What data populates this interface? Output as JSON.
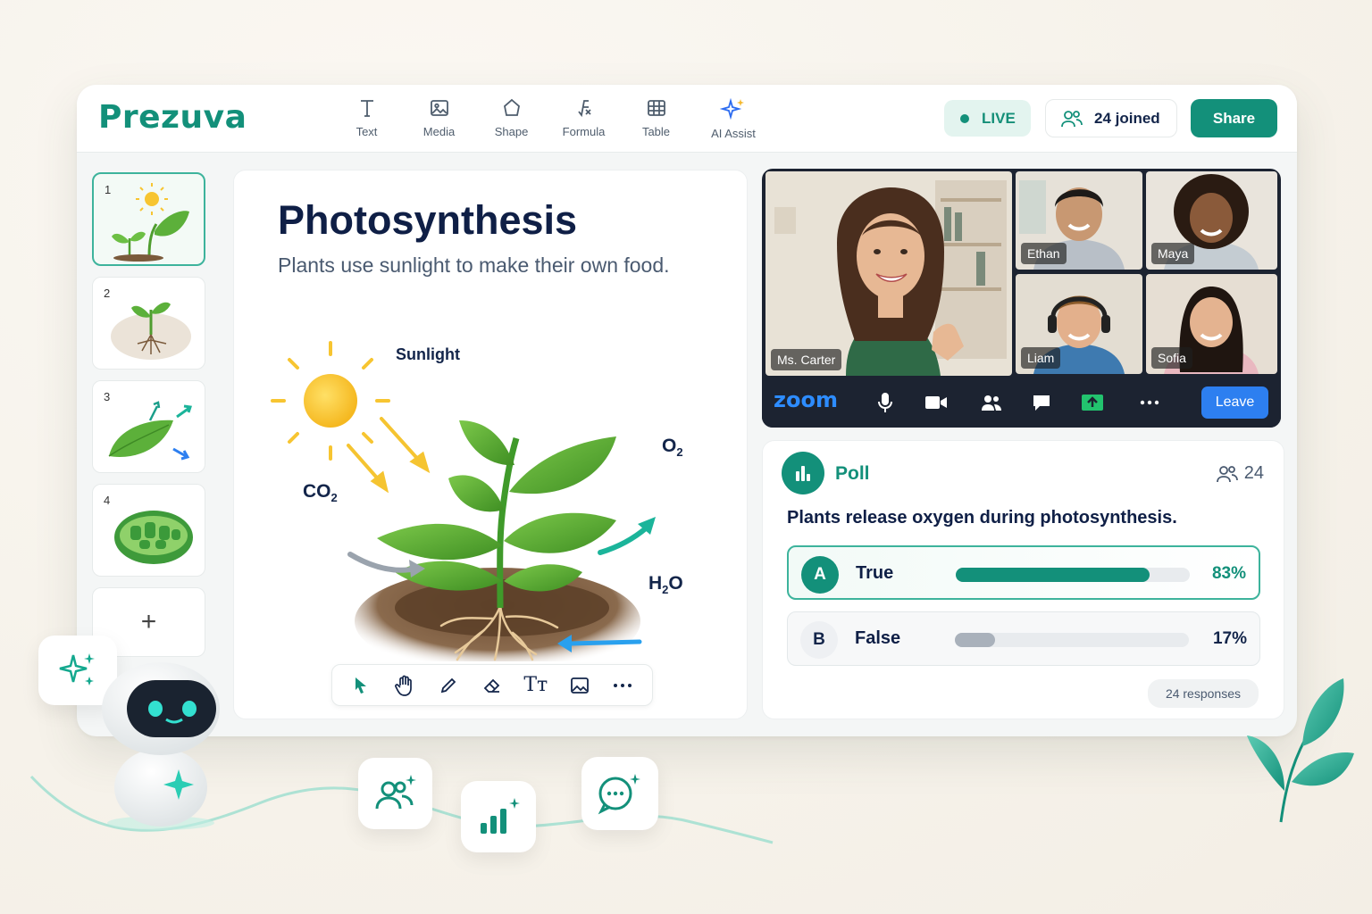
{
  "app": {
    "logo": "Prezuva"
  },
  "toolbar": {
    "tools": [
      {
        "label": "Text",
        "icon": "text-icon"
      },
      {
        "label": "Media",
        "icon": "image-icon"
      },
      {
        "label": "Shape",
        "icon": "shape-icon"
      },
      {
        "label": "Formula",
        "icon": "formula-icon"
      },
      {
        "label": "Table",
        "icon": "table-icon"
      },
      {
        "label": "AI Assist",
        "icon": "sparkle-icon"
      }
    ],
    "live_label": "LIVE",
    "joined_label": "24 joined",
    "share_label": "Share"
  },
  "slides": {
    "items": [
      {
        "num": "1",
        "icon": "sun-plant-icon",
        "active": true
      },
      {
        "num": "2",
        "icon": "roots-icon"
      },
      {
        "num": "3",
        "icon": "leaf-arrows-icon"
      },
      {
        "num": "4",
        "icon": "chloroplast-icon"
      }
    ],
    "add_label": "+"
  },
  "slide": {
    "title": "Photosynthesis",
    "subtitle": "Plants use sunlight to make their own food.",
    "labels": {
      "sunlight": "Sunlight",
      "co2": "CO",
      "co2_sub": "2",
      "o2": "O",
      "o2_sub": "2",
      "h2o_h": "H",
      "h2o_sub": "2",
      "h2o_o": "O"
    },
    "drawbar_icons": [
      "pointer-icon",
      "hand-icon",
      "pen-icon",
      "eraser-icon",
      "text-size-icon",
      "image-icon",
      "more-icon"
    ],
    "drawbar_text_glyph": "Tт"
  },
  "video": {
    "participants": [
      {
        "name": "Ms. Carter"
      },
      {
        "name": "Ethan"
      },
      {
        "name": "Maya"
      },
      {
        "name": "Liam"
      },
      {
        "name": "Sofia"
      }
    ],
    "brand": "zoom",
    "leave_label": "Leave"
  },
  "poll": {
    "title": "Poll",
    "count": "24",
    "question": "Plants release oxygen during photosynthesis.",
    "options": [
      {
        "letter": "A",
        "text": "True",
        "percent": "83%",
        "value": 83
      },
      {
        "letter": "B",
        "text": "False",
        "percent": "17%",
        "value": 17
      }
    ],
    "responses": "24 responses"
  },
  "colors": {
    "accent": "#13907a",
    "zoom_blue": "#2d8cff",
    "text_dark": "#0f1f46"
  }
}
